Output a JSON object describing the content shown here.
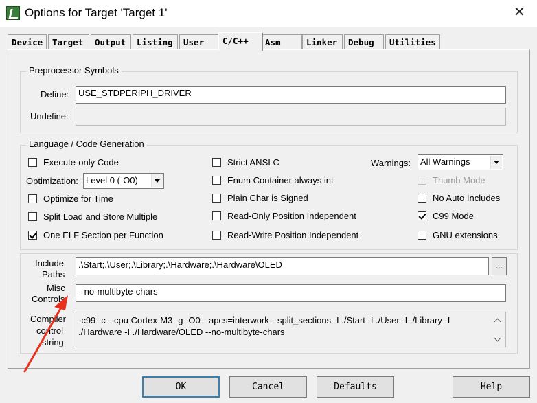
{
  "window": {
    "title": "Options for Target 'Target 1'",
    "close_icon": "close-icon"
  },
  "tabs": [
    {
      "label": "Device"
    },
    {
      "label": "Target"
    },
    {
      "label": "Output"
    },
    {
      "label": "Listing"
    },
    {
      "label": "User"
    },
    {
      "label": "C/C++"
    },
    {
      "label": "Asm"
    },
    {
      "label": "Linker"
    },
    {
      "label": "Debug"
    },
    {
      "label": "Utilities"
    }
  ],
  "active_tab": "C/C++",
  "preprocessor": {
    "group_title": "Preprocessor Symbols",
    "define_label": "Define:",
    "define_value": "USE_STDPERIPH_DRIVER",
    "undefine_label": "Undefine:",
    "undefine_value": ""
  },
  "language": {
    "group_title": "Language / Code Generation",
    "execute_only": {
      "label": "Execute-only Code",
      "checked": false
    },
    "optimization_label": "Optimization:",
    "optimization_value": "Level 0 (-O0)",
    "optimize_for_time": {
      "label": "Optimize for Time",
      "checked": false
    },
    "split_load_store": {
      "label": "Split Load and Store Multiple",
      "checked": false
    },
    "one_elf_section": {
      "label": "One ELF Section per Function",
      "checked": true
    },
    "strict_ansi_c": {
      "label": "Strict ANSI C",
      "checked": false
    },
    "enum_container": {
      "label": "Enum Container always int",
      "checked": false
    },
    "plain_char_signed": {
      "label": "Plain Char is Signed",
      "checked": false
    },
    "ro_position_independent": {
      "label": "Read-Only Position Independent",
      "checked": false
    },
    "rw_position_independent": {
      "label": "Read-Write Position Independent",
      "checked": false
    },
    "warnings_label": "Warnings:",
    "warnings_value": "All Warnings",
    "thumb_mode": {
      "label": "Thumb Mode",
      "checked": false,
      "disabled": true
    },
    "no_auto_includes": {
      "label": "No Auto Includes",
      "checked": false
    },
    "c99_mode": {
      "label": "C99 Mode",
      "checked": true
    },
    "gnu_extensions": {
      "label": "GNU extensions",
      "checked": false
    }
  },
  "paths": {
    "include_label_1": "Include",
    "include_label_2": "Paths",
    "include_value": ".\\Start;.\\User;.\\Library;.\\Hardware;.\\Hardware\\OLED",
    "browse_label": "...",
    "misc_label_1": "Misc",
    "misc_label_2": "Controls",
    "misc_value": "--no-multibyte-chars",
    "compiler_label_1": "Compiler",
    "compiler_label_2": "control",
    "compiler_label_3": "string",
    "compiler_line_1": "-c99 -c --cpu Cortex-M3 -g -O0 --apcs=interwork --split_sections -I ./Start -I ./User -I ./Library -I",
    "compiler_line_2": "./Hardware -I ./Hardware/OLED --no-multibyte-chars"
  },
  "buttons": {
    "ok": "OK",
    "cancel": "Cancel",
    "defaults": "Defaults",
    "help": "Help"
  },
  "annotation": {
    "arrow_color": "#e8321e"
  },
  "colors": {
    "checkmark": "#000000",
    "default_button_border": "#3c7fb1"
  }
}
